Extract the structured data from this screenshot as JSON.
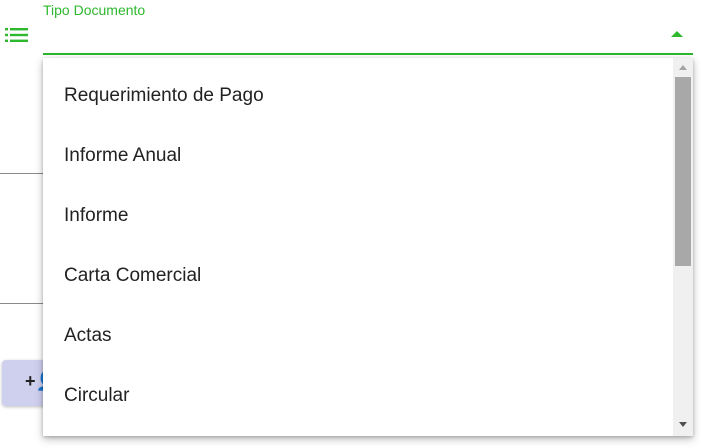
{
  "field": {
    "label": "Tipo Documento",
    "icon": "list-icon",
    "accent_color": "#2eb82e"
  },
  "background": {
    "button_icon": "add-user-icon",
    "button_glyph": "+👤"
  },
  "dropdown": {
    "options": [
      "Requerimiento de Pago",
      "Informe Anual",
      "Informe",
      "Carta Comercial",
      "Actas",
      "Circular"
    ]
  }
}
